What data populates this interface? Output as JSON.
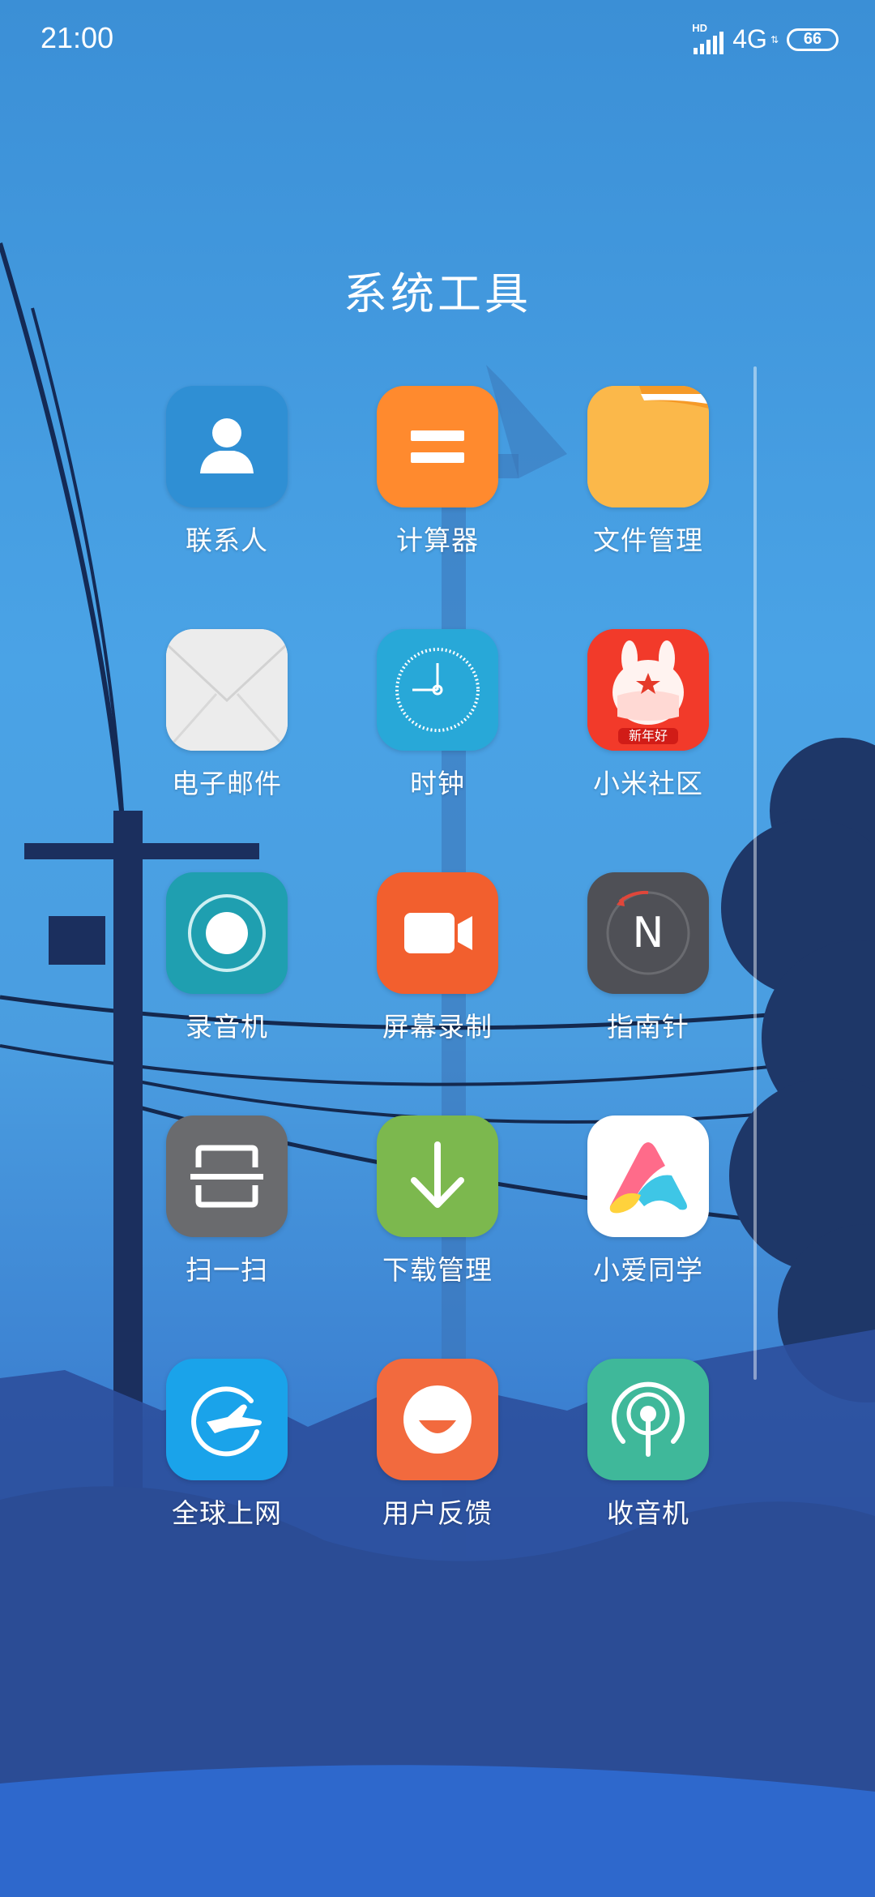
{
  "status": {
    "time": "21:00",
    "network_badge": "HD",
    "network": "4G",
    "battery": "66"
  },
  "folder": {
    "title": "系统工具"
  },
  "apps": [
    {
      "label": "联系人",
      "icon": "contacts-icon",
      "color": "#2f8fd4"
    },
    {
      "label": "计算器",
      "icon": "calculator-icon",
      "color": "#ff8a2e"
    },
    {
      "label": "文件管理",
      "icon": "folder-icon",
      "color": "#fbb84a"
    },
    {
      "label": "电子邮件",
      "icon": "mail-icon",
      "color": "#f1f1f1"
    },
    {
      "label": "时钟",
      "icon": "clock-icon",
      "color": "#28a8d8"
    },
    {
      "label": "小米社区",
      "icon": "mi-community-icon",
      "color": "#f23a2a",
      "badge_text": "新年好"
    },
    {
      "label": "录音机",
      "icon": "recorder-icon",
      "color": "#1f9fb0"
    },
    {
      "label": "屏幕录制",
      "icon": "screen-record-icon",
      "color": "#f25f2e"
    },
    {
      "label": "指南针",
      "icon": "compass-icon",
      "color": "#4f5056",
      "icon_letter": "N"
    },
    {
      "label": "扫一扫",
      "icon": "scanner-icon",
      "color": "#6a6b6e"
    },
    {
      "label": "下载管理",
      "icon": "download-icon",
      "color": "#7cb84e"
    },
    {
      "label": "小爱同学",
      "icon": "xiaoai-icon",
      "color": "#ffffff"
    },
    {
      "label": "全球上网",
      "icon": "global-internet-icon",
      "color": "#1aa3ea"
    },
    {
      "label": "用户反馈",
      "icon": "feedback-icon",
      "color": "#f26a3e"
    },
    {
      "label": "收音机",
      "icon": "radio-icon",
      "color": "#3fb89a"
    }
  ]
}
